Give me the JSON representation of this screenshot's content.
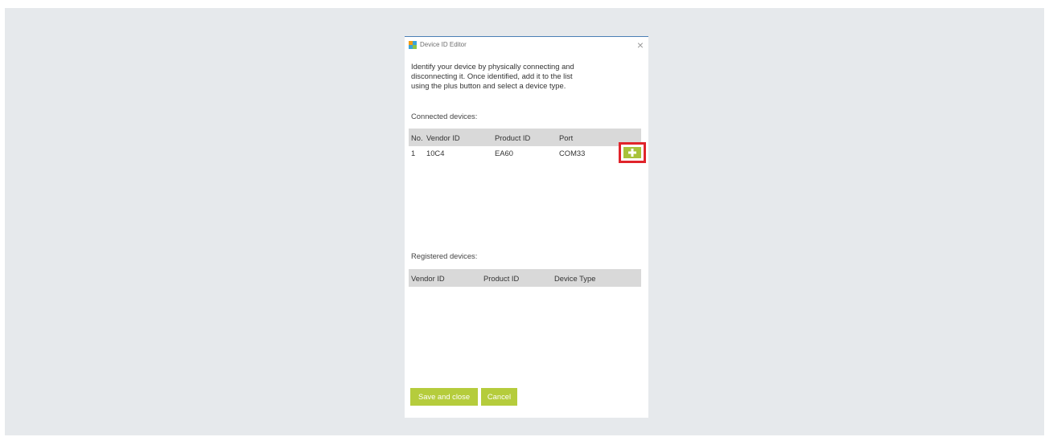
{
  "window": {
    "title": "Device ID Editor",
    "close_glyph": "×"
  },
  "instructions": {
    "line1": "Identify your device by physically connecting and",
    "line2": "disconnecting it. Once identified, add it to the list",
    "line3": "using the plus button and select a device type."
  },
  "connected": {
    "label": "Connected devices:",
    "columns": [
      "No.",
      "Vendor ID",
      "Product ID",
      "Port"
    ],
    "rows": [
      {
        "no": "1",
        "vendor_id": "10C4",
        "product_id": "EA60",
        "port": "COM33",
        "action_icon": "plus-icon"
      }
    ]
  },
  "registered": {
    "label": "Registered devices:",
    "columns": [
      "Vendor ID",
      "Product ID",
      "Device Type"
    ],
    "rows": []
  },
  "buttons": {
    "save_close": "Save and close",
    "cancel": "Cancel"
  },
  "colors": {
    "accent_green": "#b5cc3c",
    "highlight_red": "#e0242b",
    "header_gray": "#d9d9d9",
    "titlebar_blue": "#4a7fb5"
  }
}
